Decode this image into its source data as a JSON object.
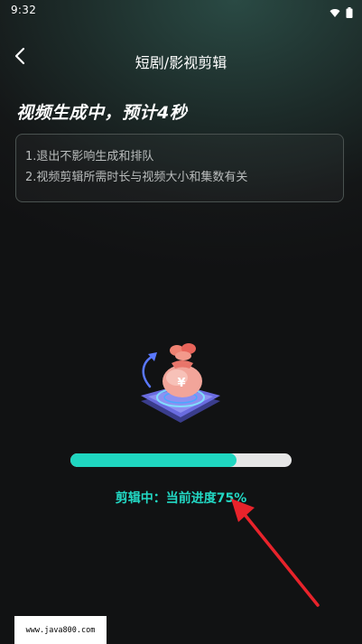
{
  "status_bar": {
    "time": "9:32",
    "icons": [
      "wifi-icon",
      "battery-icon"
    ]
  },
  "nav": {
    "back_icon": "chevron-left-icon",
    "title": "短剧/影视剪辑"
  },
  "headline": "视频生成中，预计4秒",
  "tips": [
    "1.退出不影响生成和排队",
    "2.视频剪辑所需时长与视频大小和集数有关"
  ],
  "illustration": {
    "icon": "money-bag-icon",
    "symbol": "¥"
  },
  "progress": {
    "percent": 75,
    "label": "剪辑中：当前进度75%"
  },
  "annotation": {
    "arrow_color": "#e8232b"
  },
  "watermark": "www.java800.com",
  "colors": {
    "accent": "#1fd6c0",
    "track": "#e6e6e6",
    "background": "#141617"
  }
}
